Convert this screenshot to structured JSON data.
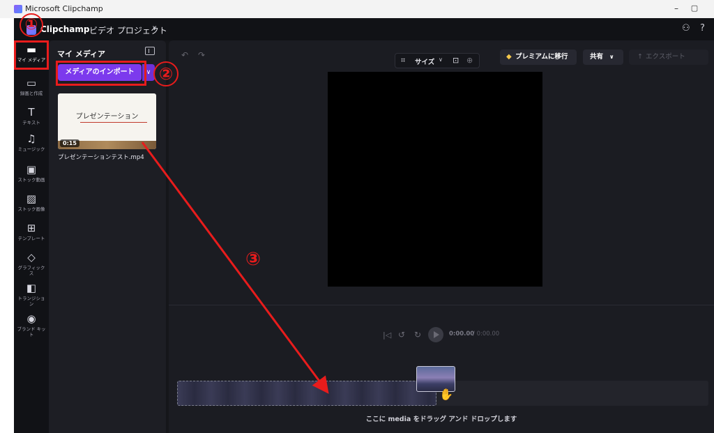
{
  "os": {
    "window_title": "Microsoft Clipchamp",
    "minimize": "–",
    "maximize": "▢"
  },
  "header": {
    "logo": "Clipchamp",
    "project_title": "ビデオ プロジェクト",
    "project_chevron": "∨",
    "people_icon": "⚇",
    "help_icon": "?"
  },
  "nav": {
    "items": [
      {
        "label": "マイ メディア",
        "icon": "folder-icon",
        "glyph": "▬",
        "active": true
      },
      {
        "label": "録画と作成",
        "icon": "camera-icon",
        "glyph": "▭"
      },
      {
        "label": "テキスト",
        "icon": "text-icon",
        "glyph": "T"
      },
      {
        "label": "ミュージック",
        "icon": "music-icon",
        "glyph": "♫"
      },
      {
        "label": "ストック動画",
        "icon": "film-icon",
        "glyph": "▣"
      },
      {
        "label": "ストック画像",
        "icon": "image-icon",
        "glyph": "▨"
      },
      {
        "label": "テンプレート",
        "icon": "template-icon",
        "glyph": "⊞"
      },
      {
        "label": "グラフィックス",
        "icon": "shapes-icon",
        "glyph": "◇"
      },
      {
        "label": "トランジション",
        "icon": "transition-icon",
        "glyph": "◧"
      },
      {
        "label": "ブランド キット",
        "icon": "brand-icon",
        "glyph": "◉"
      }
    ]
  },
  "media_panel": {
    "title": "マイ メディア",
    "import_label": "メディアのインポート",
    "import_chevron": "∨",
    "thumbnail": {
      "slide_title": "プレゼンテーション",
      "duration": "0:15",
      "file_name": "プレゼンテーションテスト.mp4"
    }
  },
  "toolbar": {
    "undo": "↶",
    "redo": "↷",
    "size_icon": "⌗",
    "size_label": "サイズ",
    "size_chevron": "∨",
    "fit_icon": "⊡",
    "zoom_icon": "⊕",
    "premium_gem": "◆",
    "premium_label": "プレミアムに移行",
    "share_label": "共有",
    "share_chevron": "∨",
    "export_arrow": "↑",
    "export_label": "エクスポート"
  },
  "playback": {
    "skip_back": "|◁",
    "rewind": "↺",
    "forward": "↻",
    "current_time": "0:00.00",
    "total_time": "/ 0:00.00"
  },
  "timeline": {
    "drop_hint": "ここに media をドラッグ アンド ドロップします",
    "hand": "✋"
  },
  "annotations": {
    "step1": "①",
    "step2": "②",
    "step3": "③",
    "color": "#e81c1c"
  }
}
